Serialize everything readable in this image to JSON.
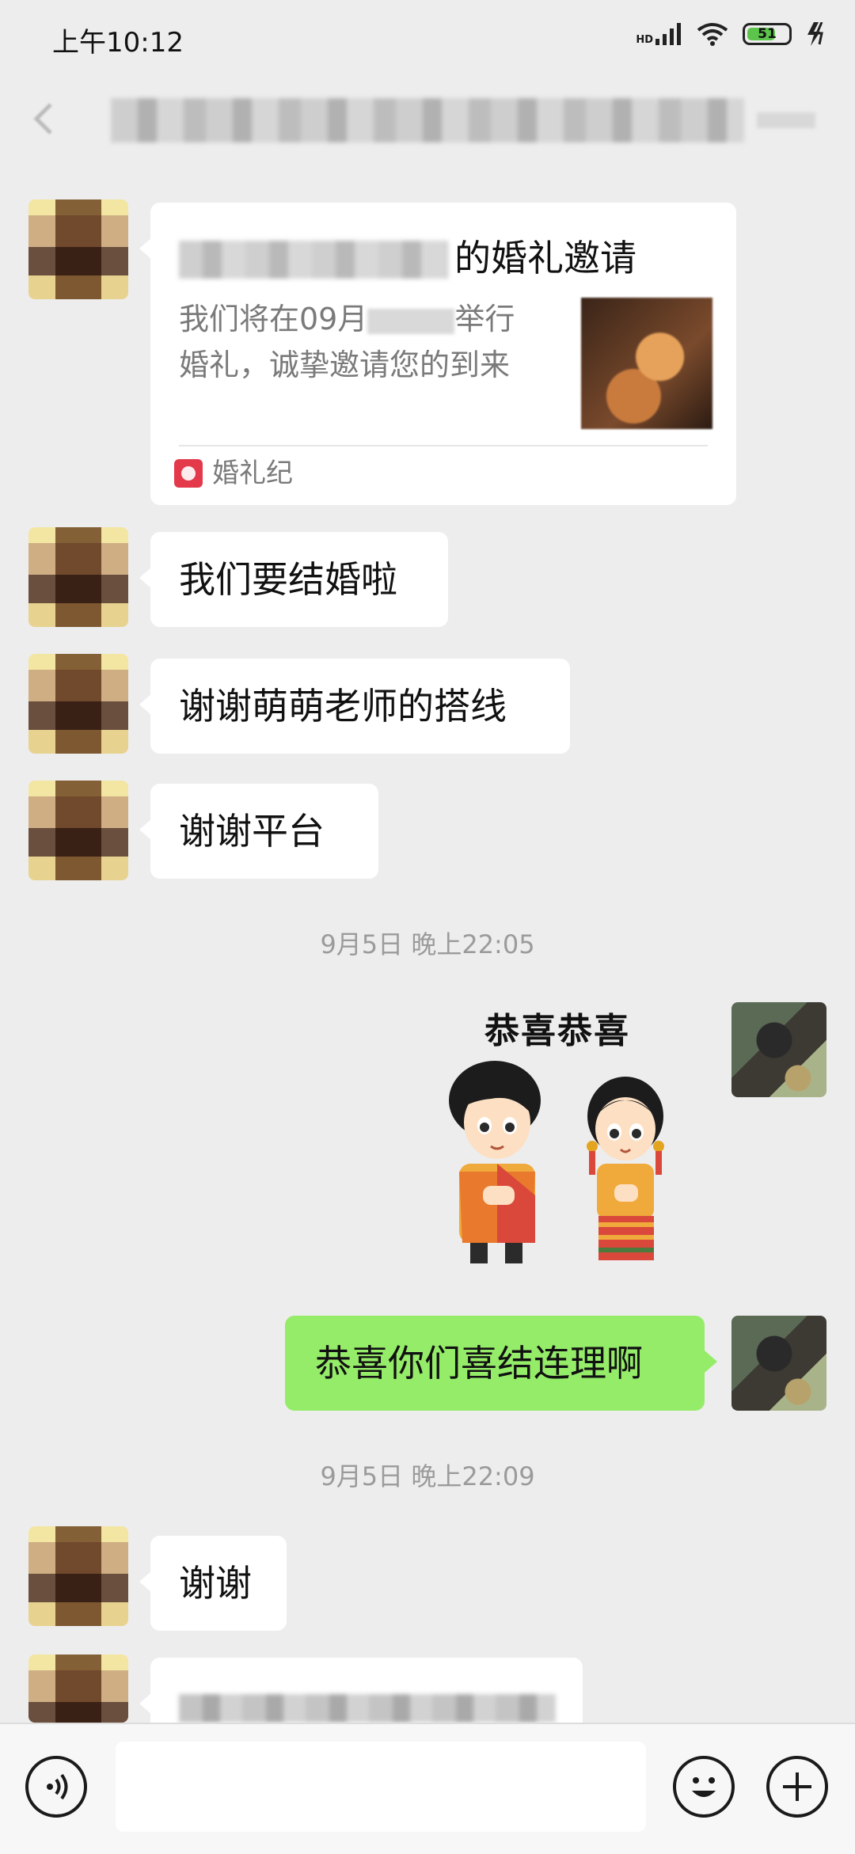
{
  "status_bar": {
    "time": "上午10:12",
    "network": "HD",
    "battery": "51"
  },
  "chat": {
    "invite_card": {
      "title": "的婚礼邀请",
      "desc_prefix": "我们将在09月",
      "desc_suffix": "举行",
      "desc_line2": "婚礼，诚挚邀请您的到来",
      "app_name": "婚礼纪"
    },
    "messages": {
      "m1": "我们要结婚啦",
      "m2": "谢谢萌萌老师的搭线",
      "m3": "谢谢平台",
      "ts1": "9月5日 晚上22:05",
      "sticker_caption": "恭喜恭喜",
      "m4": "恭喜你们喜结连理啊",
      "ts2": "9月5日 晚上22:09",
      "m5": "谢谢"
    }
  },
  "colors": {
    "background": "#ededed",
    "bubble_self": "#95ec69",
    "bubble_other": "#ffffff"
  }
}
